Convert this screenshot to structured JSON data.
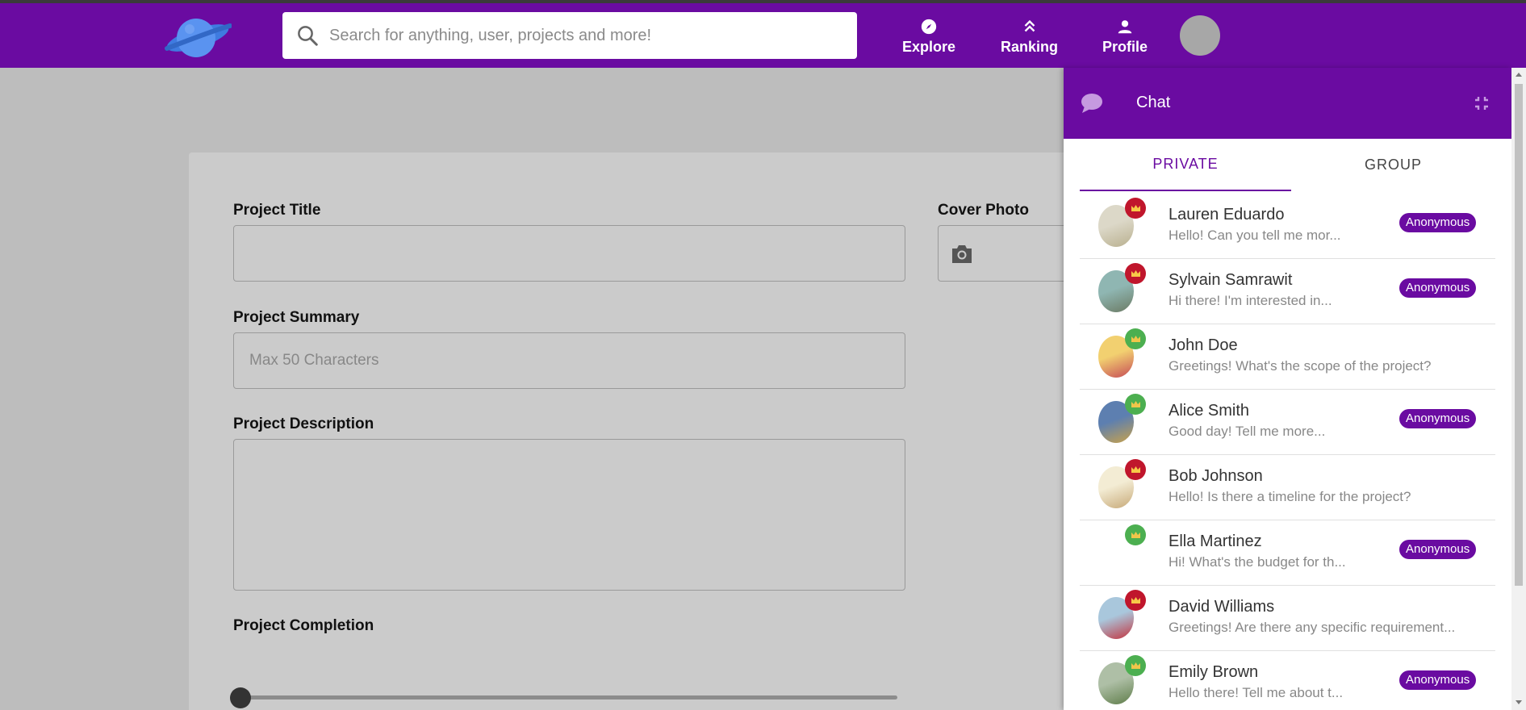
{
  "header": {
    "search_placeholder": "Search for anything, user, projects and more!",
    "nav": [
      {
        "label": "Explore",
        "icon": "compass-icon"
      },
      {
        "label": "Ranking",
        "icon": "chevrons-up-icon"
      },
      {
        "label": "Profile",
        "icon": "person-icon"
      }
    ],
    "brand_color": "#6a0ba1"
  },
  "form": {
    "project_title_label": "Project Title",
    "project_title_value": "",
    "cover_photo_label": "Cover Photo",
    "project_summary_label": "Project Summary",
    "project_summary_placeholder": "Max 50 Characters",
    "project_description_label": "Project Description",
    "project_description_value": "",
    "project_completion_label": "Project Completion",
    "project_completion_value": 0
  },
  "chat": {
    "title": "Chat",
    "tabs": [
      {
        "label": "PRIVATE",
        "active": true
      },
      {
        "label": "GROUP",
        "active": false
      }
    ],
    "conversations": [
      {
        "name": "Lauren Eduardo",
        "message": "Hello! Can you tell me mor...",
        "badge": "Anonymous",
        "status_color": "#c0162c"
      },
      {
        "name": "Sylvain Samrawit",
        "message": "Hi there! I'm interested in...",
        "badge": "Anonymous",
        "status_color": "#c0162c"
      },
      {
        "name": "John Doe",
        "message": "Greetings! What's the scope of the project?",
        "badge": "",
        "status_color": "#4caf50"
      },
      {
        "name": "Alice Smith",
        "message": "Good day! Tell me more...",
        "badge": "Anonymous",
        "status_color": "#4caf50"
      },
      {
        "name": "Bob Johnson",
        "message": "Hello! Is there a timeline for the project?",
        "badge": "",
        "status_color": "#c0162c"
      },
      {
        "name": "Ella Martinez",
        "message": "Hi! What's the budget for th...",
        "badge": "Anonymous",
        "status_color": "#4caf50"
      },
      {
        "name": "David Williams",
        "message": "Greetings! Are there any specific requirement...",
        "badge": "",
        "status_color": "#c0162c"
      },
      {
        "name": "Emily Brown",
        "message": "Hello there! Tell me about t...",
        "badge": "Anonymous",
        "status_color": "#4caf50"
      }
    ]
  }
}
